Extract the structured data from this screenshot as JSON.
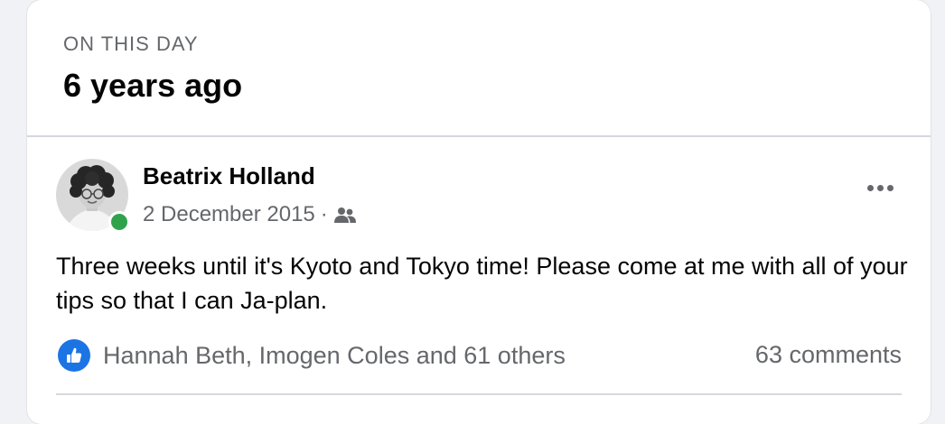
{
  "memory": {
    "eyebrow": "ON THIS DAY",
    "years_ago": "6 years ago"
  },
  "post": {
    "author": "Beatrix Holland",
    "date": "2 December 2015",
    "separator": "·",
    "audience_icon": "friends-icon",
    "online": true,
    "text": "Three weeks until it's Kyoto and Tokyo time! Please come at me with all of your tips so that I can Ja-plan.",
    "reactions_summary": "Hannah Beth, Imogen Coles and 61 others",
    "comments_count": "63 comments",
    "more_icon": "more-options-icon"
  },
  "colors": {
    "like_blue": "#1b74e4",
    "online_green": "#31a24c",
    "secondary_text": "#65676b"
  }
}
